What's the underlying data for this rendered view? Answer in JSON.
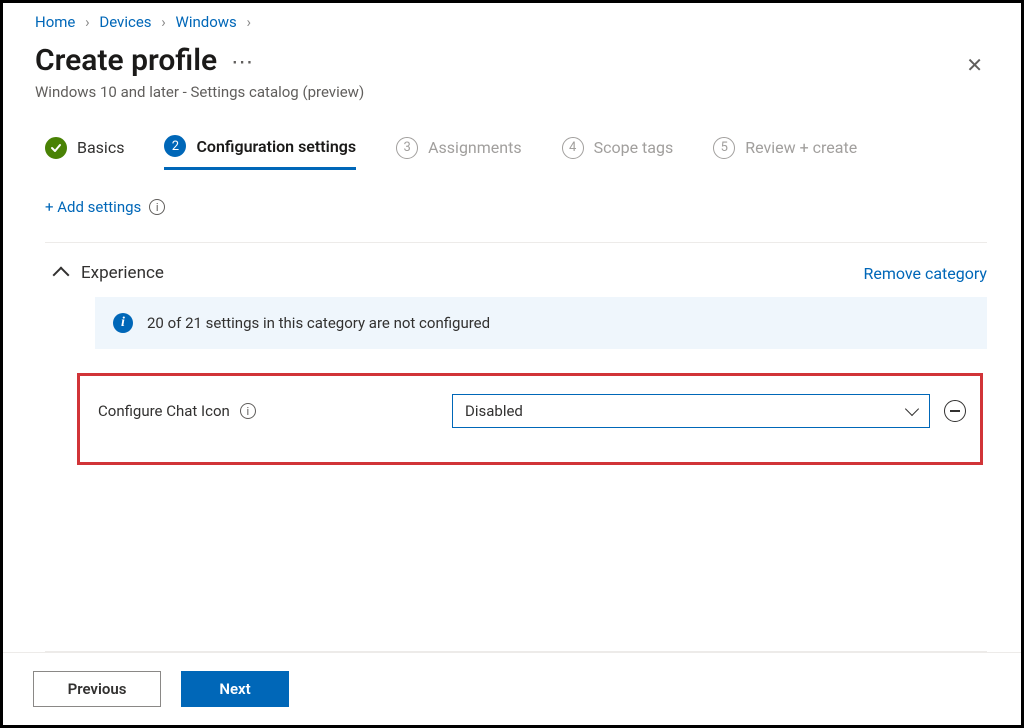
{
  "breadcrumb": {
    "items": [
      "Home",
      "Devices",
      "Windows"
    ]
  },
  "header": {
    "title": "Create profile",
    "subtitle": "Windows 10 and later - Settings catalog (preview)"
  },
  "steps": [
    {
      "num": "✓",
      "label": "Basics",
      "state": "done"
    },
    {
      "num": "2",
      "label": "Configuration settings",
      "state": "active"
    },
    {
      "num": "3",
      "label": "Assignments",
      "state": "future"
    },
    {
      "num": "4",
      "label": "Scope tags",
      "state": "future"
    },
    {
      "num": "5",
      "label": "Review + create",
      "state": "future"
    }
  ],
  "content": {
    "add_settings_label": "+ Add settings",
    "category": {
      "name": "Experience",
      "remove_label": "Remove category",
      "info_banner": "20 of 21 settings in this category are not configured",
      "setting": {
        "label": "Configure Chat Icon",
        "value": "Disabled"
      }
    }
  },
  "footer": {
    "previous": "Previous",
    "next": "Next"
  },
  "colors": {
    "accent": "#0067b8",
    "success": "#498205",
    "highlight_border": "#d13438"
  }
}
